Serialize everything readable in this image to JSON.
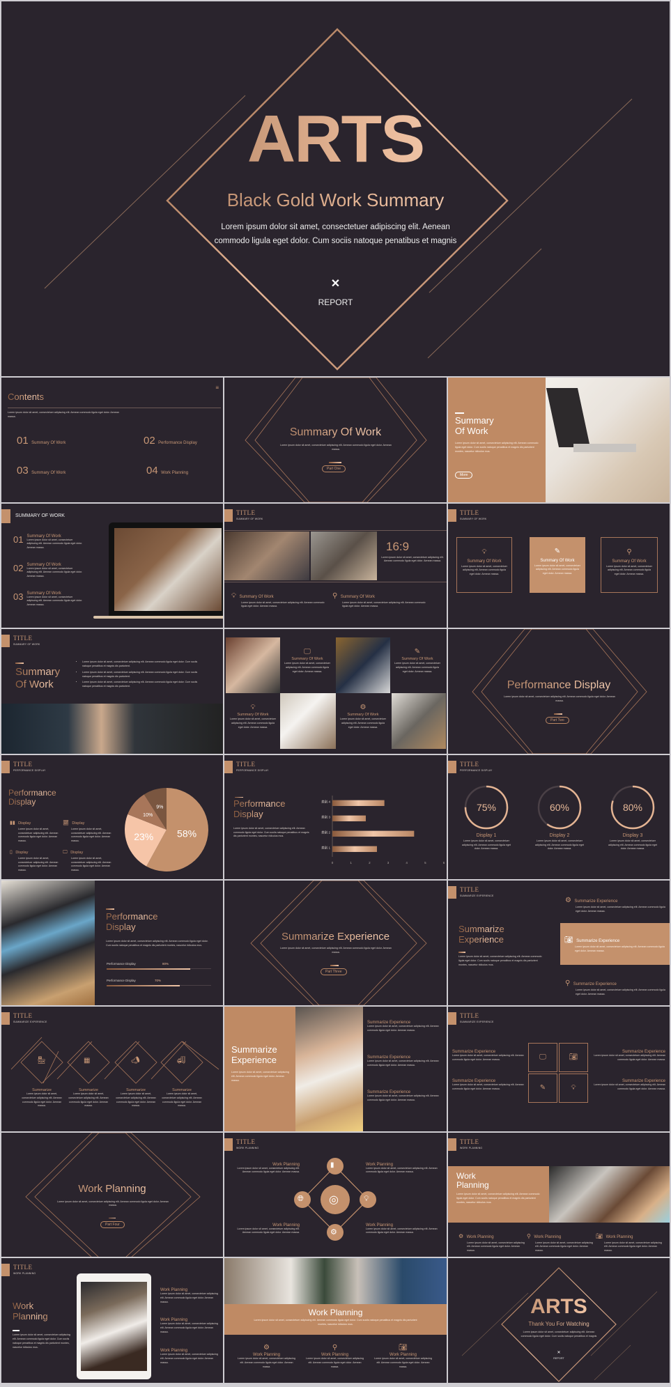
{
  "colors": {
    "background": "#2a242d",
    "accent": "#c4916c",
    "gold_light": "#f3cbb0",
    "gold_dark": "#8a5a3c",
    "text": "#e9e2dc"
  },
  "lorem": {
    "short": "Lorem ipsum dolor sit amet, consectetuer adipiscing elit. Aenean commodo ligula eget dolor. Aenean massa.",
    "long": "Lorem ipsum dolor sit amet, consectetuer adipiscing elit. Aenean commodo ligula eget dolor. Cum sociis natoque penatibus et magnis dis parturient montes, nascetur ridiculus mus.",
    "bullet": "Lorem ipsum dolor sit amet, consectetuer adipiscing elit. Aenean commodo ligula eget dolor. Cum sociis natoque penatibus et magnis dis parturient."
  },
  "cover": {
    "title": "ARTS",
    "subtitle": "Black Gold Work Summary",
    "line1": "Lorem ipsum dolor sit amet, consectetuer adipiscing elit.  Aenean",
    "line2": "commodo ligula eget dolor. Cum sociis natoque penatibus et magnis",
    "close_symbol": "✕",
    "report_label": "REPORT"
  },
  "contents": {
    "title": "Contents",
    "menu_icon": "hamburger-icon",
    "items": [
      {
        "num": "01",
        "label": "Summary Of Work"
      },
      {
        "num": "02",
        "label": "Performance Display"
      },
      {
        "num": "03",
        "label": "Summary Of Work"
      },
      {
        "num": "04",
        "label": "Work Planning"
      }
    ]
  },
  "section1": {
    "title": "Summary Of Work",
    "part": "Part One"
  },
  "section2": {
    "title": "Performance Display",
    "part": "Part Two"
  },
  "section3": {
    "title": "Summarize Experience",
    "part": "Part Three"
  },
  "section4": {
    "title": "Work Planning",
    "part": "Part Four"
  },
  "summary_intro": {
    "title_l1": "Summary",
    "title_l2": "Of Work",
    "button": "More"
  },
  "summary_list": {
    "header": "SUMMARY OF WORK",
    "items": [
      {
        "num": "01",
        "label": "Summary  Of Work"
      },
      {
        "num": "02",
        "label": "Summary  Of Work"
      },
      {
        "num": "03",
        "label": "Summary  Of Work"
      }
    ]
  },
  "slide_title": "TITLE",
  "sub_summary": "SUMMARY OF WORK",
  "sub_perf": "PERFORMANCE DISPLAY",
  "sub_summarize": "SUMMARIZE EXPERIENCE",
  "sub_planning": "WORK PLANNING",
  "ratio": {
    "label": "16:9"
  },
  "item_summary": "Summary  Of Work",
  "bullets_slide": {
    "title_l1": "Summary",
    "title_l2": "Of Work"
  },
  "perf": {
    "title_l1": "Performance",
    "title_l2": "Display",
    "display_label": "Display"
  },
  "chart_data": [
    {
      "type": "pie",
      "title": "Performance Display",
      "values": [
        58,
        23,
        10,
        9
      ],
      "labels": [
        "58%",
        "23%",
        "10%",
        "9%"
      ],
      "colors": [
        "#c4916c",
        "#f6c5a8",
        "#a8765a",
        "#7a5640"
      ]
    },
    {
      "type": "bar",
      "orientation": "horizontal",
      "categories": [
        "类别 1",
        "类别 2",
        "类别 3",
        "类别 4"
      ],
      "values": [
        2.4,
        4.4,
        1.8,
        2.8
      ],
      "xlim": [
        0,
        6
      ],
      "xticks": [
        "0",
        "1",
        "2",
        "3",
        "4",
        "5",
        "6"
      ],
      "grid": false
    },
    {
      "type": "gauge",
      "items": [
        {
          "label": "Display 1",
          "value": 75
        },
        {
          "label": "Display 2",
          "value": 60
        },
        {
          "label": "Display 3",
          "value": 80
        }
      ]
    }
  ],
  "perf_bars": [
    {
      "label": "Performance Display",
      "value": 80,
      "text": "80%"
    },
    {
      "label": "Performance Display",
      "value": 70,
      "text": "70%"
    }
  ],
  "summarize": {
    "title_l1": "Summarize",
    "title_l2": "Experience",
    "item": "Summarize Experience",
    "short": "Summarize"
  },
  "planning": {
    "title_l1": "Work",
    "title_l2": "Planning",
    "item": "Work Planning",
    "title": "Work Planning"
  },
  "thanks": {
    "title": "ARTS",
    "subtitle": "Thank You For Watching",
    "line": "Lorem ipsum dolor sit amet, consectetuer adipiscing elit. Aenean commodo ligula eget dolor. Cum sociis natoque penatibus et magnis",
    "report_label": "REPORT",
    "close_symbol": "✕"
  }
}
